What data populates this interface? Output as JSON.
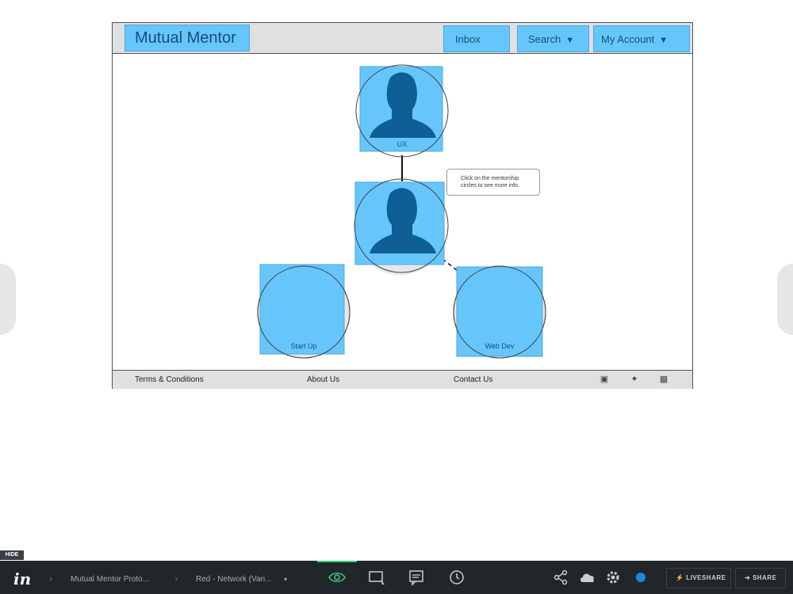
{
  "prototype": {
    "brand": "Mutual Mentor",
    "nav": {
      "inbox": "Inbox",
      "search": "Search",
      "account": "My Account"
    },
    "nodes": {
      "top": "UX",
      "left": "Start Up",
      "right": "Web Dev"
    },
    "tooltip": "Click on the mentorship circles to see more info.",
    "footer": {
      "terms": "Terms & Conditions",
      "about": "About Us",
      "contact": "Contact Us"
    },
    "social_icons": [
      "facebook-icon",
      "twitter-icon",
      "google-plus-icon"
    ]
  },
  "colors": {
    "hotspot": "#66c6fb",
    "avatar": "#0e5f95",
    "toolbar": "#21262b",
    "accent": "#37c978"
  },
  "toolbar": {
    "hide": "HIDE",
    "logo": "in",
    "project": "Mutual Mentor Proto...",
    "screen": "Red - Network (Vari...",
    "liveshare": "LIVESHARE",
    "share": "SHARE"
  }
}
